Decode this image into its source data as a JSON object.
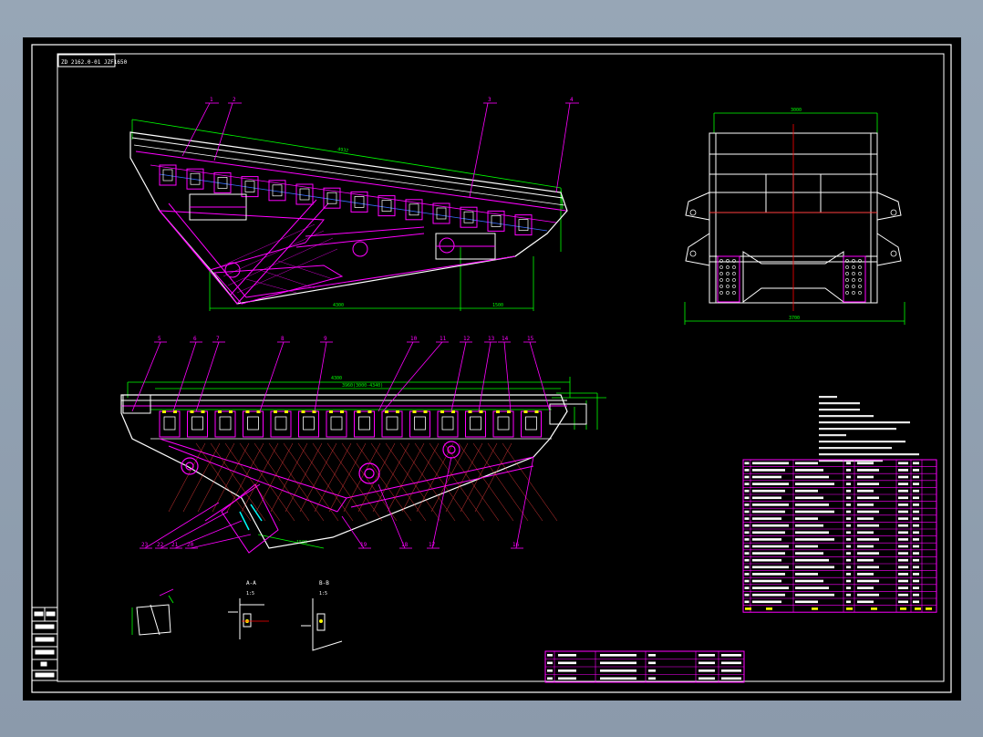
{
  "colors": {
    "background": "#000000",
    "outline": "#ffffff",
    "magenta": "#ff00ff",
    "green": "#00ff00",
    "red": "#ff0000",
    "cyan": "#00ffff",
    "yellow": "#ffff00",
    "blue": "#3a6dff"
  },
  "drawing": {
    "header_code": "ZD 2162.0-01 JZF1650",
    "balloons_top": [
      "1",
      "2",
      "3",
      "4"
    ],
    "balloons_mid": [
      "5",
      "6",
      "7",
      "8",
      "9",
      "10",
      "11",
      "12",
      "13",
      "14",
      "15"
    ],
    "balloons_bottom": [
      "23",
      "22",
      "21",
      "20",
      "19",
      "18",
      "17",
      "16"
    ],
    "section_a": "A-A",
    "section_b": "B-B",
    "scale_note": "1:5"
  }
}
